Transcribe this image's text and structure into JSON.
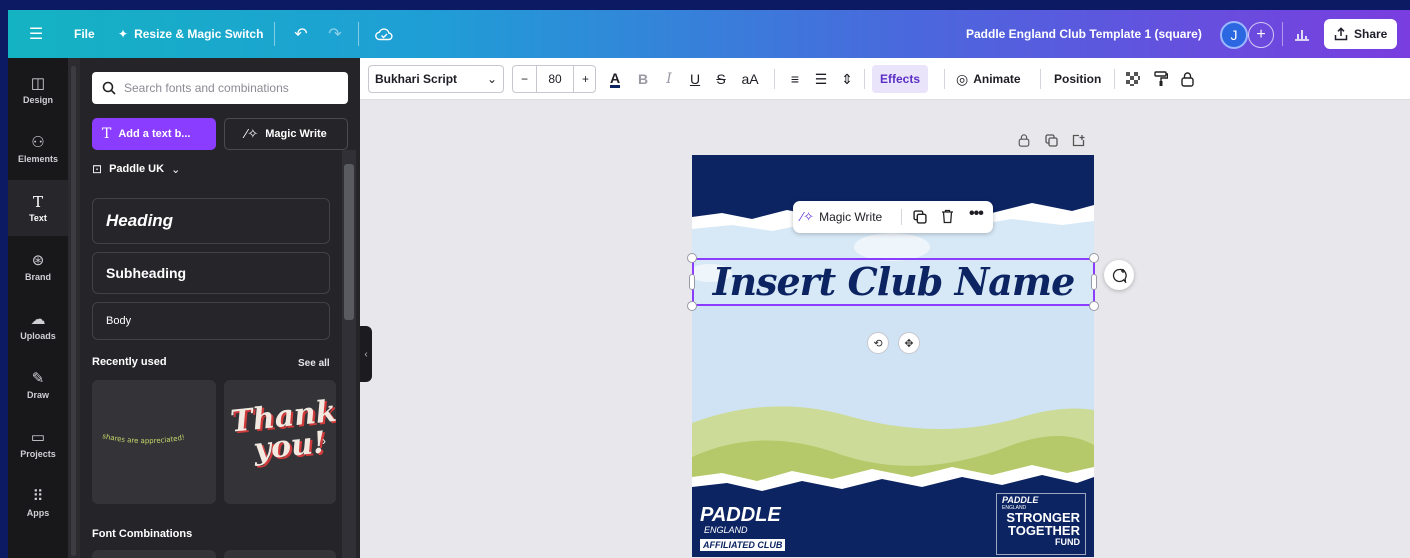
{
  "topbar": {
    "file_label": "File",
    "resize_label": "Resize & Magic Switch",
    "doc_title": "Paddle England Club Template 1 (square)",
    "avatar_initial": "J",
    "share_label": "Share"
  },
  "rail": {
    "items": [
      {
        "label": "Design"
      },
      {
        "label": "Elements"
      },
      {
        "label": "Text"
      },
      {
        "label": "Brand"
      },
      {
        "label": "Uploads"
      },
      {
        "label": "Draw"
      },
      {
        "label": "Projects"
      },
      {
        "label": "Apps"
      }
    ]
  },
  "panel": {
    "search_placeholder": "Search fonts and combinations",
    "add_text_label": "Add a text b...",
    "magic_write_label": "Magic Write",
    "brand_kit": "Paddle UK",
    "heading_label": "Heading",
    "subheading_label": "Subheading",
    "body_label": "Body",
    "recently_used": "Recently used",
    "see_all": "See all",
    "font_combinations": "Font Combinations",
    "thumb1_text": "shares are appreciated!",
    "thumb2_line1": "Thank",
    "thumb2_line2": "you!"
  },
  "toolbar": {
    "font_name": "Bukhari Script",
    "font_size": "80",
    "effects_label": "Effects",
    "animate_label": "Animate",
    "position_label": "Position"
  },
  "canvas": {
    "float_menu_magic_write": "Magic Write",
    "club_name": "Insert Club Name",
    "logo_left": {
      "line1": "PADDLE",
      "line2": "ENGLAND",
      "line3": "AFFILIATED CLUB"
    },
    "logo_right": {
      "line1": "PADDLE",
      "line2": "ENGLAND",
      "line3": "STRONGER",
      "line4": "TOGETHER",
      "line5": "FUND"
    }
  },
  "colors": {
    "accent_purple": "#8b3dff",
    "canvas_navy": "#0d2463",
    "hills_green": "#b5c96a"
  }
}
